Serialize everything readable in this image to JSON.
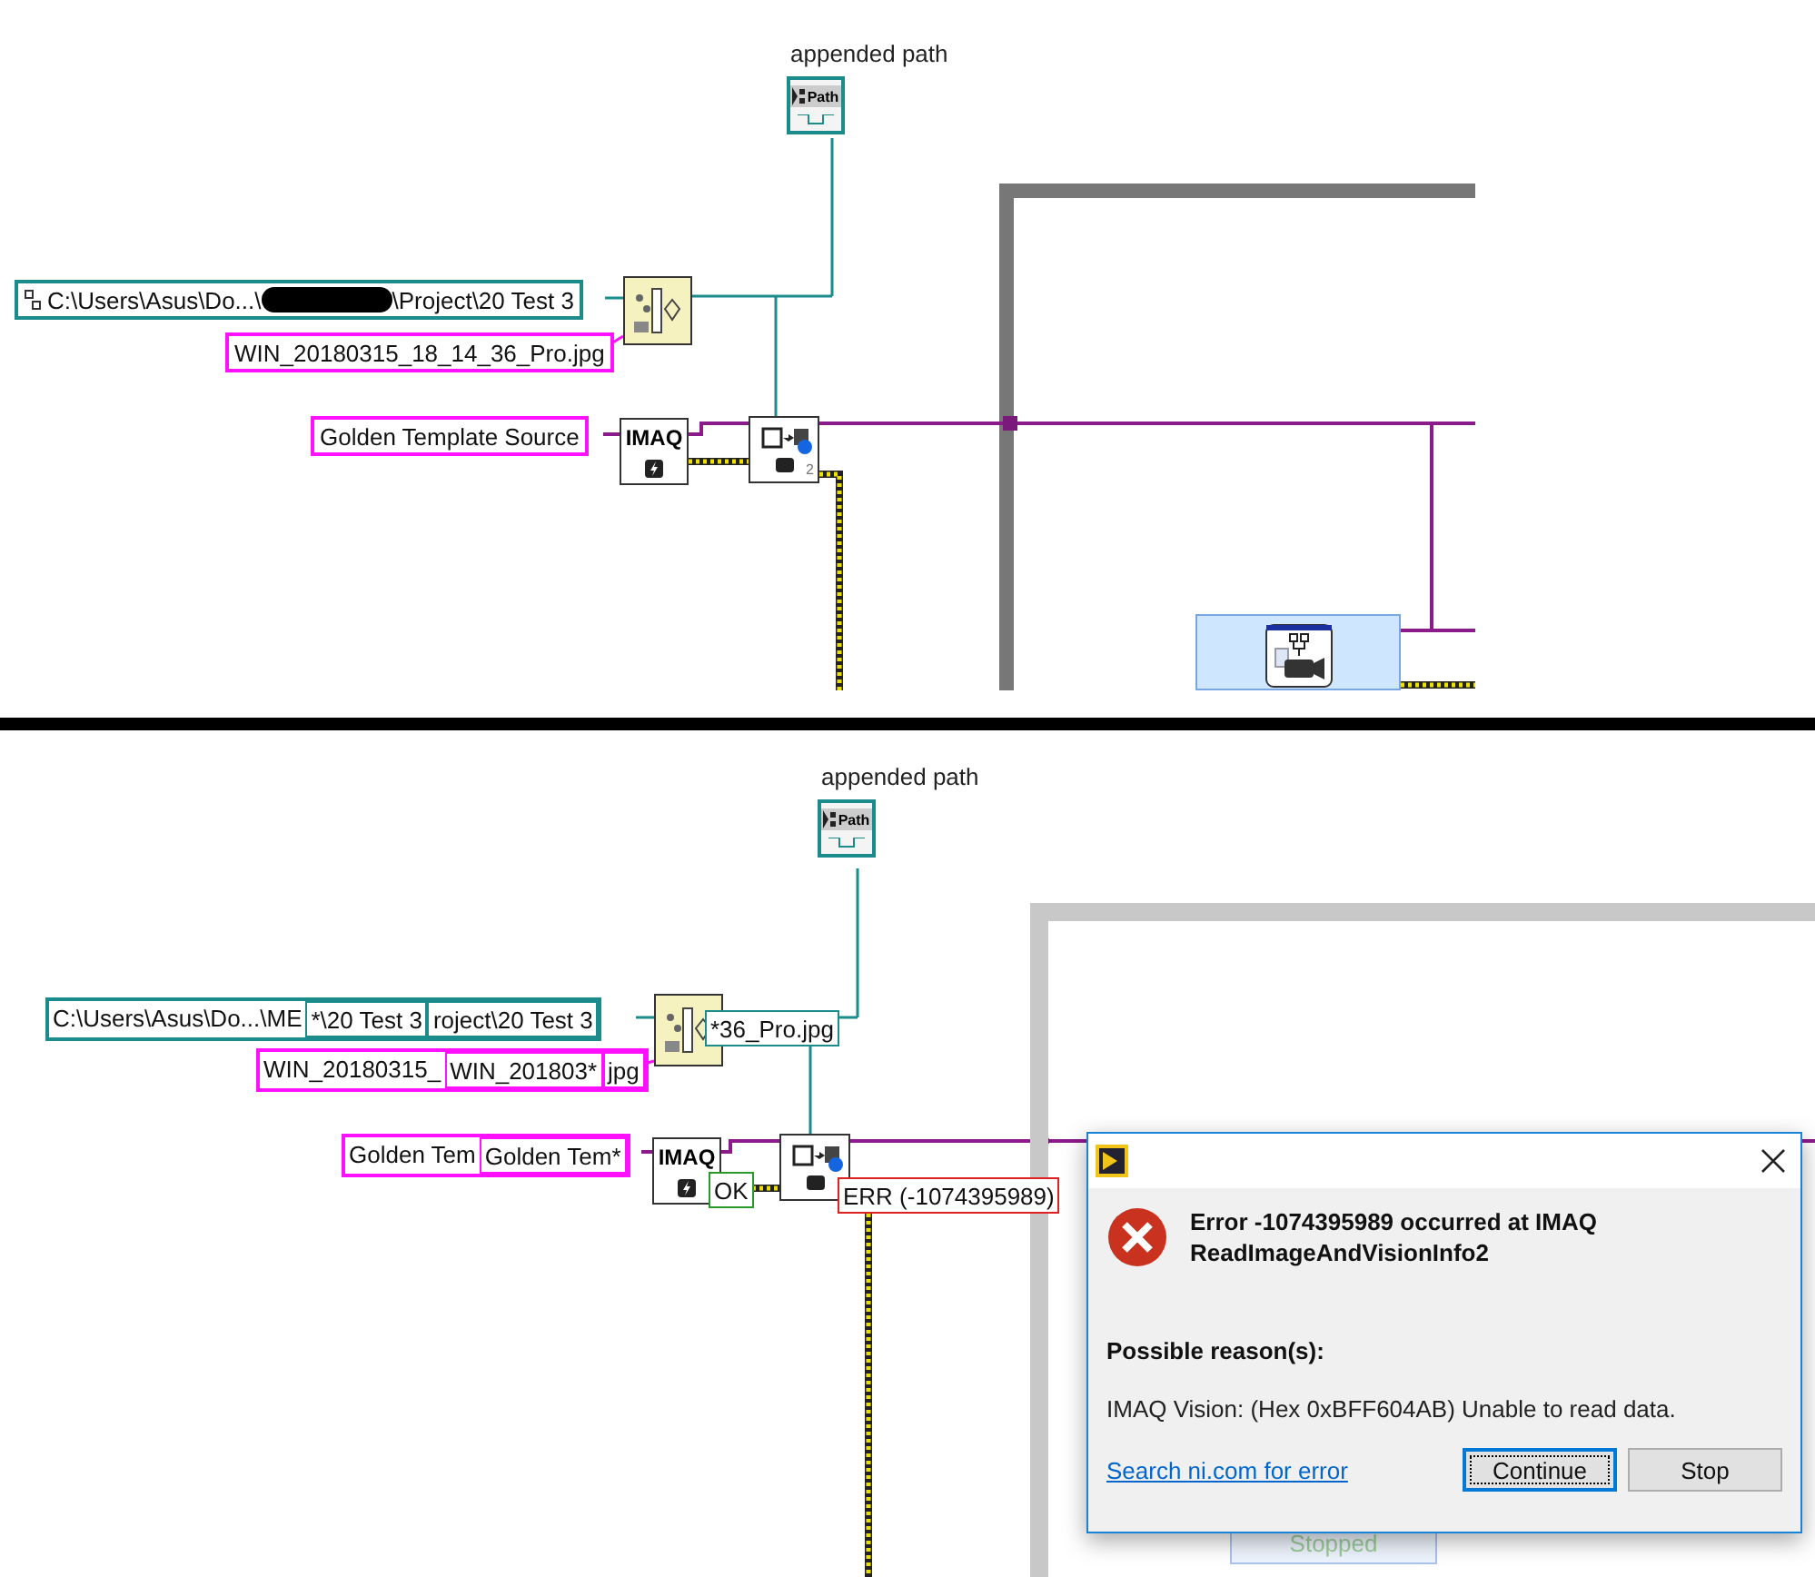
{
  "top_diagram": {
    "indicator": {
      "label": "appended path",
      "text": "Path"
    },
    "path_constant": {
      "segments": [
        {
          "kind": "text",
          "text": "C:\\Users\\Asus\\Do...\\"
        },
        {
          "kind": "redacted"
        },
        {
          "kind": "text",
          "text": "\\Project\\20 Test 3"
        }
      ]
    },
    "file_constant": "WIN_20180315_18_14_36_Pro.jpg",
    "session_constant": "Golden Template Source",
    "imaq_label": "IMAQ",
    "read_node_count": "2"
  },
  "bottom_diagram": {
    "indicator": {
      "label": "appended path",
      "text": "Path"
    },
    "path_constant": [
      "C:\\Users\\Asus\\Do...\\ME",
      "*\\20 Test 3",
      "roject\\20 Test 3"
    ],
    "path_probe": "*36_Pro.jpg",
    "file_constant": [
      "WIN_20180315_",
      "WIN_201803*",
      "jpg"
    ],
    "session_constant": [
      "Golden Tem",
      "Golden Tem*"
    ],
    "imaq_label": "IMAQ",
    "status_probe": "OK",
    "error_probe": "ERR (-1074395989)",
    "behind_dialog": {
      "state": "Stopped"
    }
  },
  "dialog": {
    "heading": "Error -1074395989 occurred at IMAQ ReadImageAndVisionInfo2",
    "reasons_title": "Possible reason(s):",
    "reason": "IMAQ Vision:  (Hex 0xBFF604AB) Unable to read data.",
    "link": "Search ni.com for error",
    "buttons": [
      {
        "label": "Continue",
        "selected": true
      },
      {
        "label": "Stop",
        "selected": false
      }
    ]
  }
}
